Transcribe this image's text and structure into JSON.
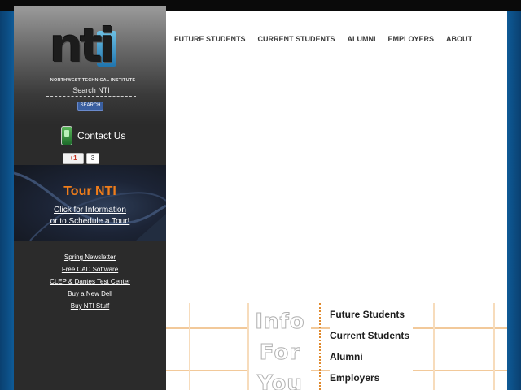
{
  "site": {
    "logo_text": "nti",
    "logo_subtitle": "NORTHWEST TECHNICAL INSTITUTE"
  },
  "search": {
    "label": "Search NTI",
    "button": "SEARCH"
  },
  "contact": {
    "label": "Contact Us"
  },
  "gplus": {
    "button": "+1",
    "count": "3"
  },
  "tour": {
    "title": "Tour NTI",
    "line1": "Click for Information",
    "line2": "or to Schedule a Tour!"
  },
  "sidebar_links": [
    "Spring Newsletter",
    "Free CAD Software",
    "CLEP & Dantes Test Center",
    "Buy a New Dell",
    "Buy NTI Stuff"
  ],
  "nav": [
    "FUTURE STUDENTS",
    "CURRENT STUDENTS",
    "ALUMNI",
    "EMPLOYERS",
    "ABOUT"
  ],
  "info": {
    "words": [
      "Info",
      "For",
      "You"
    ],
    "links": [
      "Future Students",
      "Current Students",
      "Alumni",
      "Employers"
    ]
  },
  "colors": {
    "page_bg": "#0b4f86",
    "sidebar_bg": "#2b2b2b",
    "tour_accent": "#f07d1a",
    "grid_line": "#f2c99a",
    "nav_text": "#3a3a3a"
  }
}
